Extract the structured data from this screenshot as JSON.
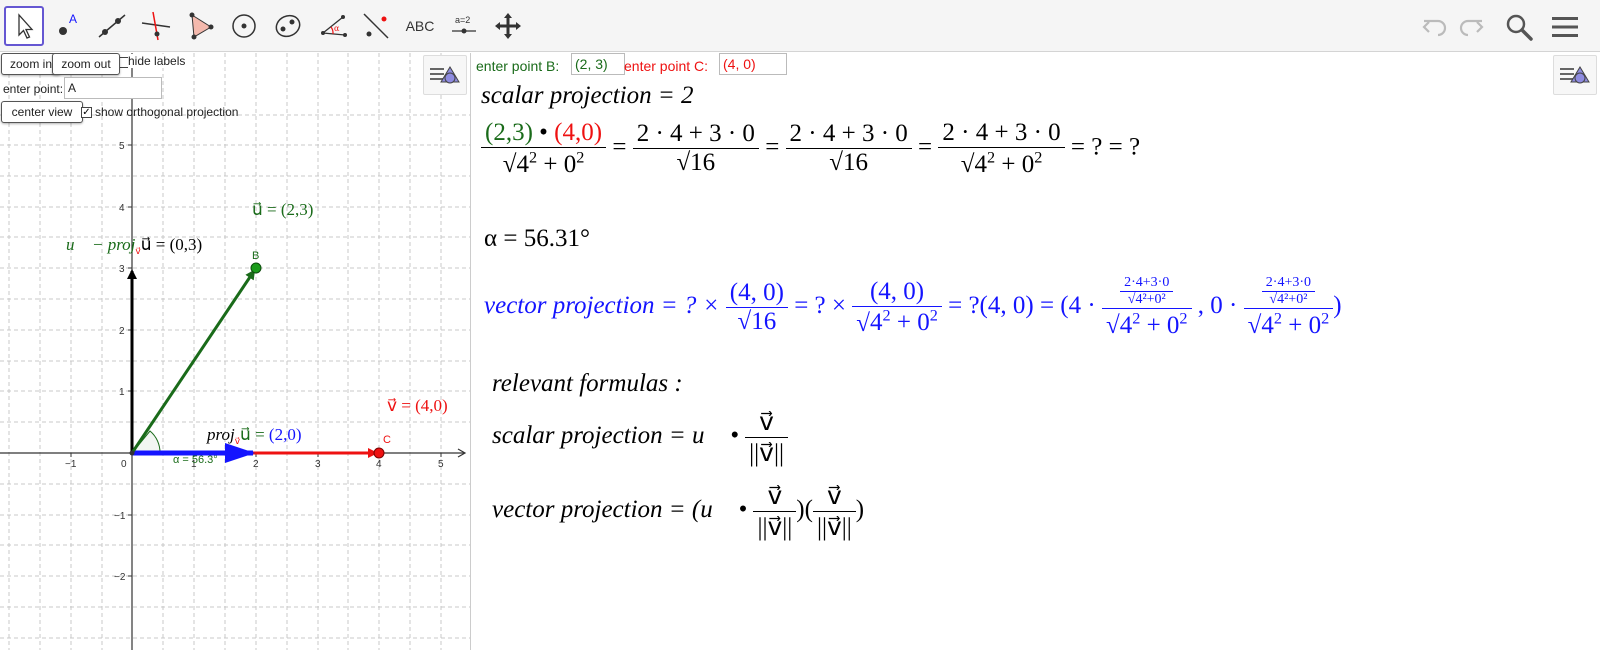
{
  "toolbar": {
    "tools": [
      {
        "name": "move",
        "label": ""
      },
      {
        "name": "point",
        "label": "A"
      },
      {
        "name": "line",
        "label": ""
      },
      {
        "name": "perpendicular-line",
        "label": ""
      },
      {
        "name": "polygon",
        "label": ""
      },
      {
        "name": "circle",
        "label": ""
      },
      {
        "name": "ellipse",
        "label": ""
      },
      {
        "name": "angle",
        "label": "α"
      },
      {
        "name": "reflect",
        "label": ""
      },
      {
        "name": "text",
        "label": "ABC"
      },
      {
        "name": "slider",
        "label": "a=2"
      },
      {
        "name": "move-graphics",
        "label": ""
      }
    ]
  },
  "graphics": {
    "zoom_in_label": "zoom in",
    "zoom_out_label": "zoom out",
    "hide_labels_label": "hide labels",
    "enter_point_label": "enter point:",
    "enter_point_value": "A",
    "center_view_label": "center view",
    "show_projection_label": "show orthogonal projection",
    "show_projection_checked": "✓",
    "label_u": "u⃗ = (2,3)",
    "label_v": "v⃗ = (4,0)",
    "label_perp": "u⃗ − proj",
    "label_perp_sub": "v⃗",
    "label_perp_tail": "u⃗ = (0,3)",
    "label_proj": "proj",
    "label_proj_sub": "v⃗",
    "label_proj_u": "u⃗ = ",
    "label_proj_value": "(2,0)",
    "point_b": "B",
    "point_c": "C",
    "angle_label": "α = 56.3°",
    "x_ticks": [
      "−1",
      "0",
      "1",
      "2",
      "3",
      "4",
      "5"
    ],
    "y_ticks": [
      "5",
      "4",
      "3",
      "2",
      "1",
      "−1",
      "−2"
    ]
  },
  "panel": {
    "enter_b_label": "enter point B:",
    "enter_b_value": "(2, 3)",
    "enter_c_label": "enter point C:",
    "enter_c_value": "(4, 0)",
    "scalar_line": "scalar projection = 2",
    "eq": {
      "u": "(2,3)",
      "dot": " • ",
      "v": "(4,0)",
      "num": "2 · 4 + 3 · 0",
      "den_a": "4",
      "den_b": "0",
      "sqrt16": "16",
      "tail": " = ? = ?"
    },
    "alpha_line": "α = 56.31°",
    "vector_line": {
      "prefix": "vector projection = ? × ",
      "frac_num": "(4, 0)",
      "mid": " = ? × ",
      "mid2": " = ?(4, 0) = (4 · ",
      "sep": " , 0 · ",
      "end": ")",
      "small_num": "2·4+3·0",
      "small_den": "4²+0²"
    },
    "relevant": "relevant formulas :",
    "scalar_formula_prefix": "scalar projection = u⃗ • ",
    "vector_formula_prefix": "vector projection = (u⃗ • ",
    "v_vec": "v⃗",
    "norm_v": "||v⃗||",
    "close_open": ")(",
    "close": ")"
  },
  "colors": {
    "accent": "#6557d2",
    "green": "#1a6b1a",
    "red": "#e11111",
    "blue": "#1414ff"
  }
}
